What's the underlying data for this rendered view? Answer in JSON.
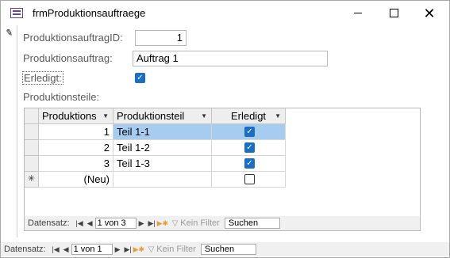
{
  "window": {
    "title": "frmProduktionsauftraege"
  },
  "form": {
    "id_label": "ProduktionsauftragID:",
    "id_value": "1",
    "name_label": "Produktionsauftrag:",
    "name_value": "Auftrag 1",
    "done_label": "Erledigt:",
    "done_checked": true,
    "parts_label": "Produktionsteile:"
  },
  "subform": {
    "columns": [
      "Produktions",
      "Produktionsteil",
      "Erledigt"
    ],
    "rows": [
      {
        "id": "1",
        "name": "Teil 1-1",
        "done": true
      },
      {
        "id": "2",
        "name": "Teil 1-2",
        "done": true
      },
      {
        "id": "3",
        "name": "Teil 1-3",
        "done": true
      }
    ],
    "new_row_label": "(Neu)",
    "new_row_marker": "✳",
    "nav": {
      "label": "Datensatz:",
      "position": "1 von 3",
      "filter": "Kein Filter",
      "search": "Suchen"
    }
  },
  "nav": {
    "label": "Datensatz:",
    "position": "1 von 1",
    "filter": "Kein Filter",
    "search": "Suchen"
  }
}
